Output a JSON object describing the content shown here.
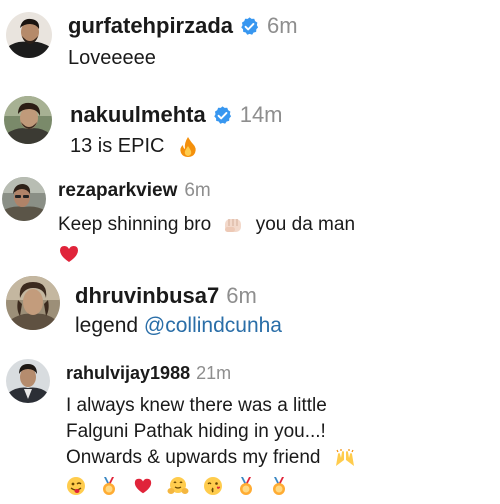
{
  "comments": [
    {
      "username": "gurfatehpirzada",
      "verified": true,
      "time": "6m",
      "text": "Loveeeee"
    },
    {
      "username": "nakuulmehta",
      "verified": true,
      "time": "14m",
      "text": "13 is EPIC",
      "emoji": "fire"
    },
    {
      "username": "rezaparkview",
      "verified": false,
      "time": "6m",
      "text_before": "Keep shinning bro",
      "text_after": "you da man",
      "emojis": [
        "fist-bump",
        "red-heart"
      ]
    },
    {
      "username": "dhruvinbusa7",
      "verified": false,
      "time": "6m",
      "text": "legend",
      "mention": "@collindcunha"
    },
    {
      "username": "rahulvijay1988",
      "verified": false,
      "time": "21m",
      "lines": [
        "I always knew there was a little",
        "Falguni Pathak hiding in you...!",
        "Onwards & upwards my friend"
      ],
      "emojis": [
        "raising-hands",
        "winking-tongue-face",
        "medal",
        "red-heart",
        "hugging-face",
        "kissing-face",
        "medal",
        "medal"
      ]
    }
  ],
  "colors": {
    "text": "#1a1a1a",
    "timestamp": "#8e8e8e",
    "mention": "#2a6ea8",
    "verified_badge": "#3897f0"
  }
}
